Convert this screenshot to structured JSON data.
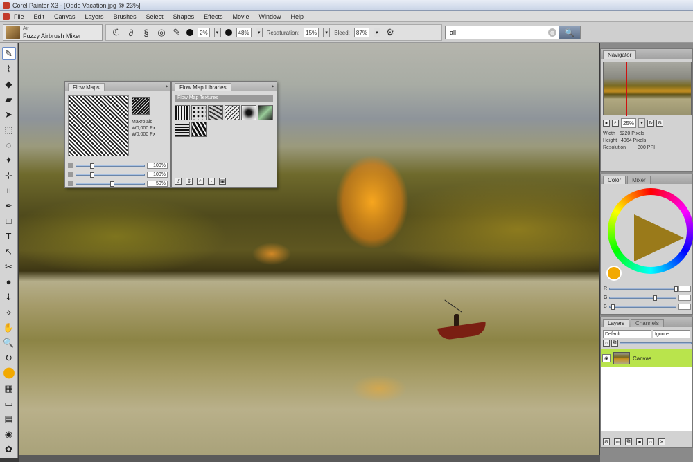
{
  "window": {
    "title": "Corel Painter X3 - [Oddo Vacation.jpg @ 23%]"
  },
  "menu": [
    "File",
    "Edit",
    "Canvas",
    "Layers",
    "Brushes",
    "Select",
    "Shapes",
    "Effects",
    "Movie",
    "Window",
    "Help"
  ],
  "brush": {
    "category": "Air",
    "variant": "Fuzzy Airbrush Mixer"
  },
  "propbar": {
    "size_value": "2%",
    "opacity_value": "48%",
    "resaturation_label": "Resaturation:",
    "resaturation_value": "15%",
    "bleed_label": "Bleed:",
    "bleed_value": "87%"
  },
  "search": {
    "value": "all",
    "clear": "⊗",
    "button": "🔍"
  },
  "flow_maps": {
    "tab": "Flow Maps",
    "info": [
      "Maxrolaid",
      "W0,000 Px",
      "W0,000 Px"
    ],
    "sliders": [
      {
        "value": "100%",
        "level": 0.2
      },
      {
        "value": "100%",
        "level": 0.2
      },
      {
        "value": "50%",
        "level": 0.5
      }
    ]
  },
  "flow_library": {
    "tab": "Flow Map Libraries",
    "section": "Flow Map Textures"
  },
  "navigator": {
    "tab": "Navigator",
    "zoom": "25%",
    "info_labels": [
      "Width",
      "Height",
      "Resolution"
    ],
    "info_values": [
      "6220 Pixels",
      "4064 Pixels",
      "300 PPI"
    ]
  },
  "color_panel": {
    "tabs": [
      "Color",
      "Mixer"
    ],
    "current_color": "#f2a900",
    "rows": [
      {
        "label": "R",
        "level": 0.98
      },
      {
        "label": "G",
        "level": 0.66
      },
      {
        "label": "B",
        "level": 0.02
      }
    ]
  },
  "layers": {
    "tabs": [
      "Layers",
      "Channels"
    ],
    "composite": "Default",
    "method": "Ignore",
    "items": [
      {
        "name": "Canvas"
      }
    ]
  }
}
